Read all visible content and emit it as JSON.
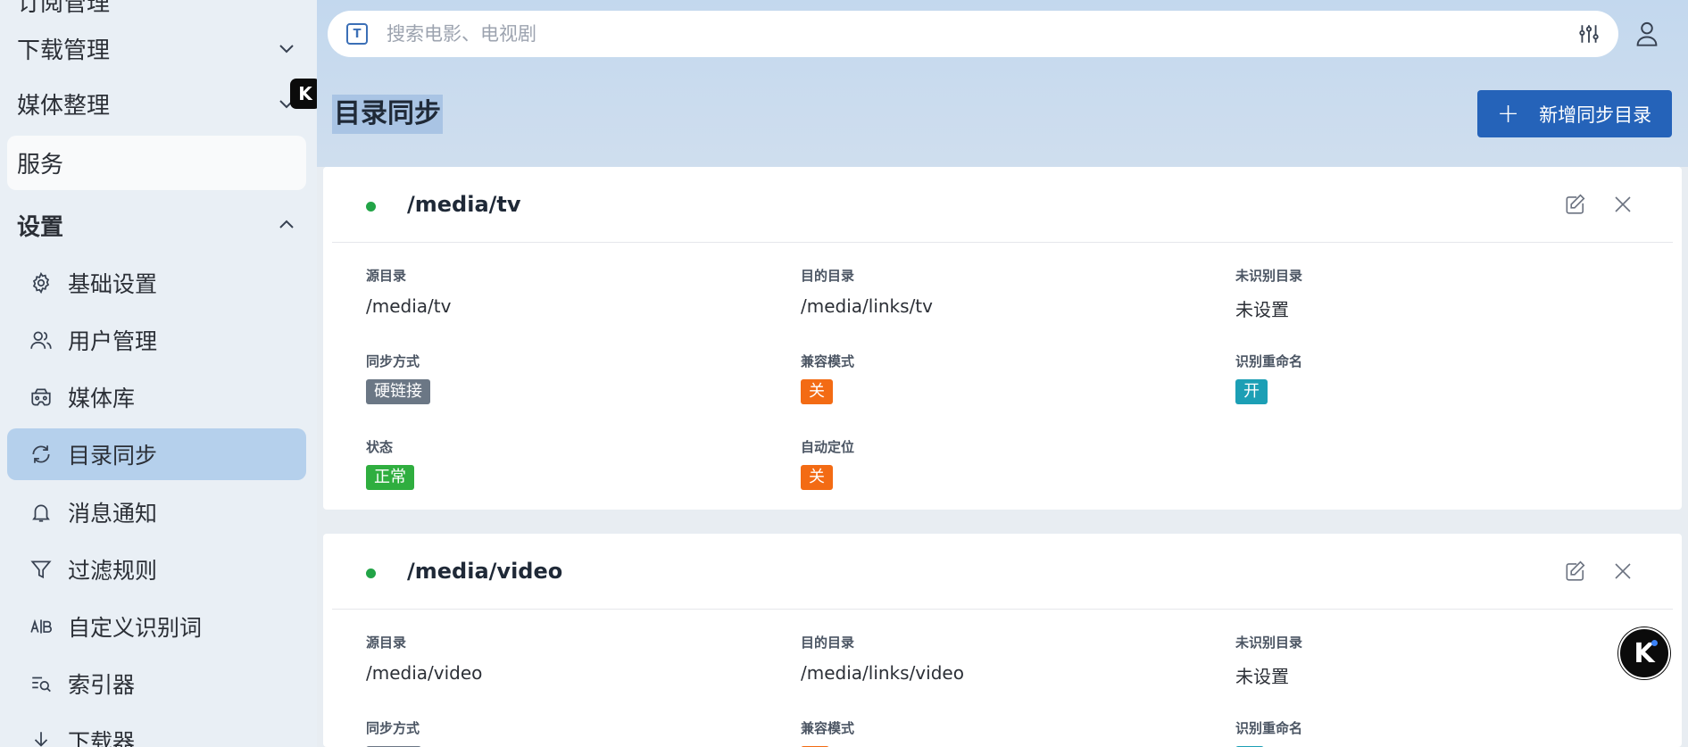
{
  "sidebar": {
    "top_partial": "订阅管理",
    "groups": [
      {
        "label": "下载管理",
        "expanded": false
      },
      {
        "label": "媒体整理",
        "expanded": false
      },
      {
        "label": "服务"
      },
      {
        "label": "设置",
        "expanded": true
      }
    ],
    "items": [
      {
        "label": "基础设置",
        "icon": "gear-icon"
      },
      {
        "label": "用户管理",
        "icon": "users-icon"
      },
      {
        "label": "媒体库",
        "icon": "media-library-icon"
      },
      {
        "label": "目录同步",
        "icon": "sync-icon",
        "selected": true
      },
      {
        "label": "消息通知",
        "icon": "bell-icon"
      },
      {
        "label": "过滤规则",
        "icon": "filter-icon"
      },
      {
        "label": "自定义识别词",
        "icon": "ab-icon"
      },
      {
        "label": "索引器",
        "icon": "indexer-icon"
      },
      {
        "label": "下载器",
        "icon": "download-icon"
      }
    ]
  },
  "search": {
    "placeholder": "搜索电影、电视剧",
    "value": ""
  },
  "page": {
    "title": "目录同步",
    "add_button": "新增同步目录"
  },
  "cards": [
    {
      "path": "/media/tv",
      "status_color": "#22a447",
      "fields": {
        "source": {
          "label": "源目录",
          "value": "/media/tv"
        },
        "target": {
          "label": "目的目录",
          "value": "/media/links/tv"
        },
        "unknown": {
          "label": "未识别目录",
          "value": "未设置"
        },
        "sync_mode": {
          "label": "同步方式",
          "value": "硬链接"
        },
        "compat": {
          "label": "兼容模式",
          "value": "关"
        },
        "rename": {
          "label": "识别重命名",
          "value": "开"
        },
        "status": {
          "label": "状态",
          "value": "正常"
        },
        "locate": {
          "label": "自动定位",
          "value": "关"
        }
      }
    },
    {
      "path": "/media/video",
      "status_color": "#22a447",
      "fields": {
        "source": {
          "label": "源目录",
          "value": "/media/video"
        },
        "target": {
          "label": "目的目录",
          "value": "/media/links/video"
        },
        "unknown": {
          "label": "未识别目录",
          "value": "未设置"
        },
        "sync_mode": {
          "label": "同步方式"
        },
        "compat": {
          "label": "兼容模式"
        },
        "rename": {
          "label": "识别重命名"
        }
      }
    }
  ],
  "badge": {
    "letter": "K"
  },
  "colors": {
    "accent": "#2563b9",
    "selected_bg": "#b5d0ec",
    "gray_chip": "#6b7785",
    "orange_chip": "#f36b14",
    "teal_chip": "#1c9fb5",
    "green_chip": "#2fae3f"
  }
}
